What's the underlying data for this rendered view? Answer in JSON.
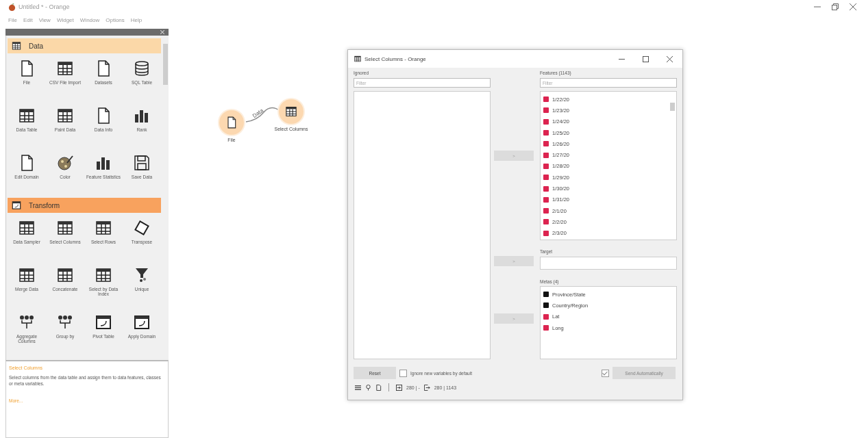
{
  "window": {
    "title": "Untitled * - Orange"
  },
  "menu": [
    "File",
    "Edit",
    "View",
    "Widget",
    "Window",
    "Options",
    "Help"
  ],
  "toolbox": {
    "categories": [
      {
        "name": "Data",
        "color": "#fbd8a8",
        "widgets": [
          "File",
          "CSV File Import",
          "Datasets",
          "SQL Table",
          "Data Table",
          "Paint Data",
          "Data Info",
          "Rank",
          "Edit Domain",
          "Color",
          "Feature Statistics",
          "Save Data"
        ]
      },
      {
        "name": "Transform",
        "color": "#f8a25e",
        "widgets": [
          "Data Sampler",
          "Select Columns",
          "Select Rows",
          "Transpose",
          "Merge Data",
          "Concatenate",
          "Select by Data Index",
          "Unique",
          "Aggregate Columns",
          "Group by",
          "Pivot Table",
          "Apply Domain"
        ]
      }
    ]
  },
  "description": {
    "title": "Select Columns",
    "text": "Select columns from the data table and assign them to data features, classes or meta variables.",
    "link": "More..."
  },
  "canvas": {
    "nodes": [
      {
        "label": "File"
      },
      {
        "label": "Select Columns"
      }
    ],
    "links": [
      {
        "label": "Data"
      }
    ]
  },
  "dialog": {
    "title": "Select Columns - Orange",
    "ignored": {
      "label": "Ignored",
      "placeholder": "Filter"
    },
    "features": {
      "label": "Features (1143)",
      "placeholder": "Filter",
      "items": [
        {
          "name": "1/22/20",
          "kind": "numeric"
        },
        {
          "name": "1/23/20",
          "kind": "numeric"
        },
        {
          "name": "1/24/20",
          "kind": "numeric"
        },
        {
          "name": "1/25/20",
          "kind": "numeric"
        },
        {
          "name": "1/26/20",
          "kind": "numeric"
        },
        {
          "name": "1/27/20",
          "kind": "numeric"
        },
        {
          "name": "1/28/20",
          "kind": "numeric"
        },
        {
          "name": "1/29/20",
          "kind": "numeric"
        },
        {
          "name": "1/30/20",
          "kind": "numeric"
        },
        {
          "name": "1/31/20",
          "kind": "numeric"
        },
        {
          "name": "2/1/20",
          "kind": "numeric"
        },
        {
          "name": "2/2/20",
          "kind": "numeric"
        },
        {
          "name": "2/3/20",
          "kind": "numeric"
        }
      ]
    },
    "target": {
      "label": "Target"
    },
    "metas": {
      "label": "Metas (4)",
      "items": [
        {
          "name": "Province/State",
          "kind": "string"
        },
        {
          "name": "Country/Region",
          "kind": "string"
        },
        {
          "name": "Lat",
          "kind": "numeric"
        },
        {
          "name": "Long",
          "kind": "numeric"
        }
      ]
    },
    "move_buttons": [
      ">",
      ">",
      ">"
    ],
    "reset": "Reset",
    "ignore_new": {
      "label": "Ignore new variables by default",
      "checked": false
    },
    "auto_send": {
      "label": "Send Automatically",
      "checked": true,
      "disabled": true
    },
    "status": {
      "input": "280 | -",
      "output": "280 | 1143"
    }
  }
}
